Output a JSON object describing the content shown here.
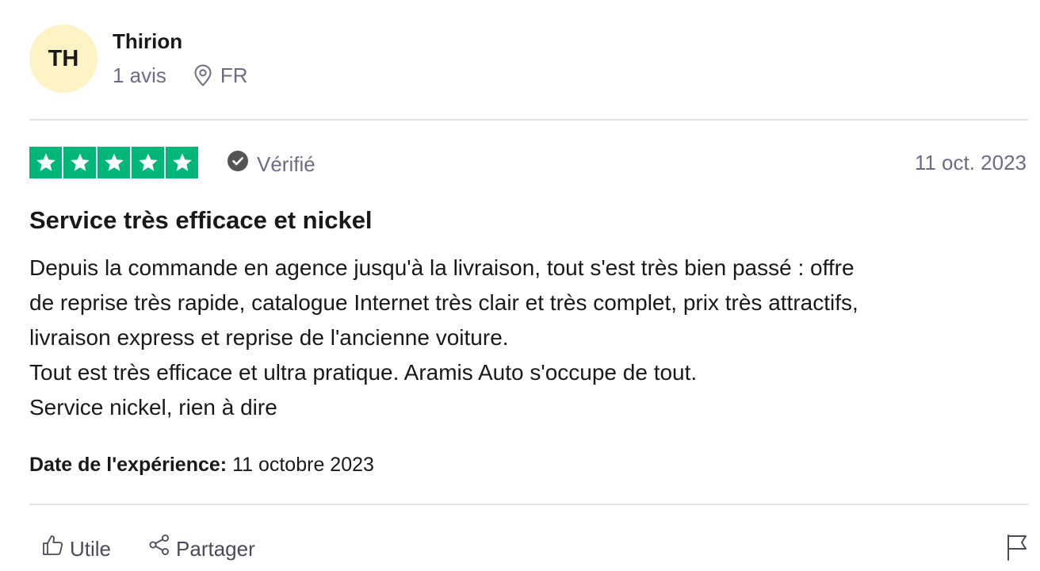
{
  "review": {
    "author": {
      "initials": "TH",
      "name": "Thirion",
      "review_count": "1 avis",
      "country": "FR"
    },
    "rating": 5,
    "verified_label": "Vérifié",
    "date": "11 oct. 2023",
    "title": "Service très efficace et nickel",
    "body_lines": [
      "Depuis la commande en agence jusqu'à la livraison, tout s'est très bien passé : offre",
      "de reprise très rapide, catalogue Internet très clair et très complet, prix très attractifs,",
      "livraison express et reprise de l'ancienne voiture.",
      "Tout est très efficace et ultra pratique. Aramis Auto s'occupe de tout.",
      "Service nickel, rien à dire"
    ],
    "experience_label": "Date de l'expérience:",
    "experience_date": "11 octobre 2023"
  },
  "actions": {
    "useful_label": "Utile",
    "share_label": "Partager"
  },
  "colors": {
    "star_green": "#00b67a",
    "avatar_bg": "#fdf3c4",
    "muted_text": "#6c6c85",
    "divider": "#e5e5dd"
  },
  "icons": [
    "location-pin-icon",
    "check-circle-icon",
    "star-icon",
    "thumbs-up-icon",
    "share-icon",
    "flag-icon"
  ]
}
